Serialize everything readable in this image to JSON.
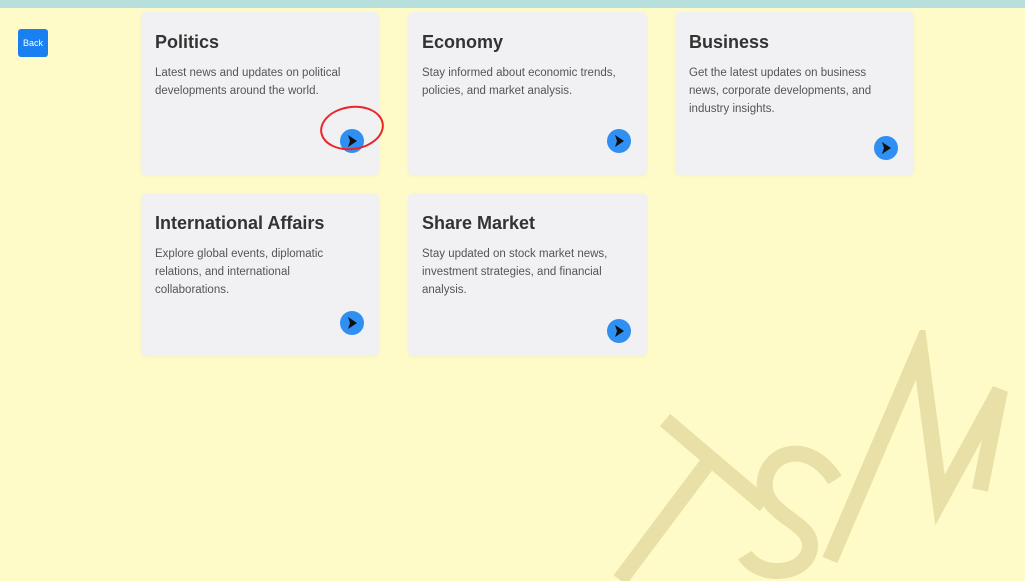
{
  "back_button": {
    "label": "Back"
  },
  "cards": [
    {
      "title": "Politics",
      "description": "Latest news and updates on political developments around the world."
    },
    {
      "title": "Economy",
      "description": "Stay informed about economic trends, policies, and market analysis."
    },
    {
      "title": "Business",
      "description": "Get the latest updates on business news, corporate developments, and industry insights."
    },
    {
      "title": "International Affairs",
      "description": "Explore global events, diplomatic relations, and international collaborations."
    },
    {
      "title": "Share Market",
      "description": "Stay updated on stock market news, investment strategies, and financial analysis."
    }
  ],
  "watermark": {
    "text": "TSM"
  },
  "colors": {
    "background": "#fffbc9",
    "card": "#f1f0f2",
    "accent": "#2f8ff2",
    "back_button": "#1a7ff0",
    "highlight": "#e8262b",
    "watermark": "#e8e0a6"
  },
  "icons": {
    "card_arrow": "arrow-right-icon"
  }
}
